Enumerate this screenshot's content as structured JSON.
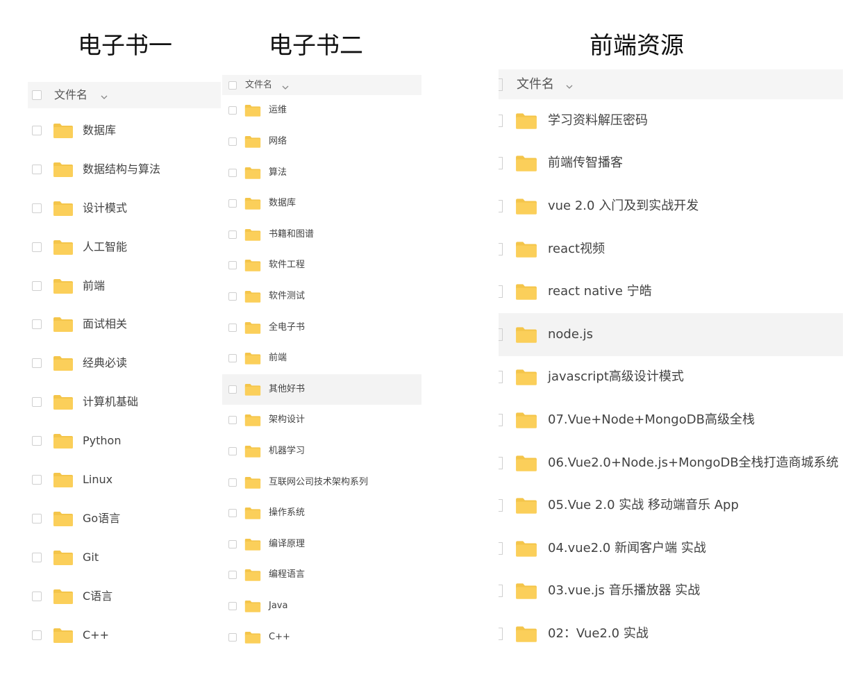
{
  "panels": [
    {
      "title": "电子书一",
      "header_label": "文件名",
      "items": [
        "数据库",
        "数据结构与算法",
        "设计模式",
        "人工智能",
        "前端",
        "面试相关",
        "经典必读",
        "计算机基础",
        "Python",
        "Linux",
        "Go语言",
        "Git",
        "C语言",
        "C++"
      ]
    },
    {
      "title": "电子书二",
      "header_label": "文件名",
      "items": [
        "运维",
        "网络",
        "算法",
        "数据库",
        "书籍和图谱",
        "软件工程",
        "软件测试",
        "全电子书",
        "前端",
        "其他好书",
        "架构设计",
        "机器学习",
        "互联网公司技术架构系列",
        "操作系统",
        "编译原理",
        "编程语言",
        "Java",
        "C++"
      ],
      "highlighted_item": "其他好书"
    },
    {
      "title": "前端资源",
      "header_label": "文件名",
      "items": [
        "学习资料解压密码",
        "前端传智播客",
        "vue 2.0 入门及到实战开发",
        "react视频",
        "react native 宁皓",
        "node.js",
        "javascript高级设计模式",
        "07.Vue+Node+MongoDB高级全栈",
        "06.Vue2.0+Node.js+MongoDB全栈打造商城系统",
        "05.Vue 2.0 实战 移动端音乐 App",
        "04.vue2.0 新闻客户端 实战",
        "03.vue.js 音乐播放器 实战",
        "02：Vue2.0 实战"
      ],
      "highlighted_item": "node.js"
    }
  ],
  "icons": {
    "folder": "folder-icon",
    "sort": "chevron-down-icon",
    "checkbox": "checkbox"
  },
  "colors": {
    "folder": "#FBCF5A",
    "folder_tab": "#F4C54A",
    "header_bg": "#F5F5F5",
    "highlight_bg": "#F3F3F3",
    "checkbox_border": "#CFCFCF"
  }
}
